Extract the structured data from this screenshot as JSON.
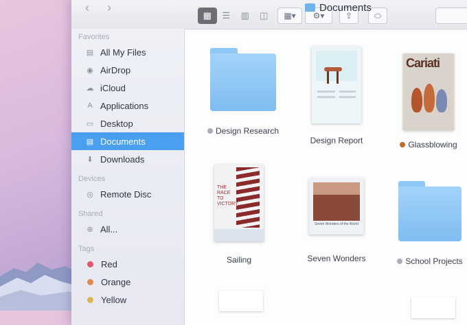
{
  "window": {
    "title": "Documents"
  },
  "toolbar": {
    "back_icon": "chevron-left-icon",
    "forward_icon": "chevron-right-icon",
    "views": [
      "icon-view",
      "list-view",
      "column-view",
      "coverflow-view"
    ],
    "selected_view": "icon-view"
  },
  "sidebar": {
    "favorites_header": "Favorites",
    "favorites": [
      {
        "label": "All My Files",
        "icon": "all-files-icon"
      },
      {
        "label": "AirDrop",
        "icon": "airdrop-icon"
      },
      {
        "label": "iCloud",
        "icon": "cloud-icon"
      },
      {
        "label": "Applications",
        "icon": "applications-icon"
      },
      {
        "label": "Desktop",
        "icon": "desktop-icon"
      },
      {
        "label": "Documents",
        "icon": "documents-icon",
        "selected": true
      },
      {
        "label": "Downloads",
        "icon": "downloads-icon"
      }
    ],
    "devices_header": "Devices",
    "devices": [
      {
        "label": "Remote Disc",
        "icon": "disc-icon"
      }
    ],
    "shared_header": "Shared",
    "shared": [
      {
        "label": "All...",
        "icon": "network-icon"
      }
    ],
    "tags_header": "Tags",
    "tags": [
      {
        "label": "Red",
        "color": "#e0566b"
      },
      {
        "label": "Orange",
        "color": "#e08a4e"
      },
      {
        "label": "Yellow",
        "color": "#d9b64b"
      }
    ]
  },
  "files": [
    {
      "name": "Design Research",
      "kind": "folder",
      "tag_color": "#a9aebb"
    },
    {
      "name": "Design Report",
      "kind": "document"
    },
    {
      "name": "Glassblowing",
      "kind": "document",
      "tag_color": "#c06b2e"
    },
    {
      "name": "Sailing",
      "kind": "document"
    },
    {
      "name": "Seven Wonders",
      "kind": "document"
    },
    {
      "name": "School Projects",
      "kind": "folder",
      "tag_color": "#a9aebb"
    }
  ],
  "thumbs": {
    "glass_cover": "Cariati",
    "sailing_cover": "THE RACE TO VICTORY",
    "seven_cover": "Seven Wonders of the World"
  }
}
